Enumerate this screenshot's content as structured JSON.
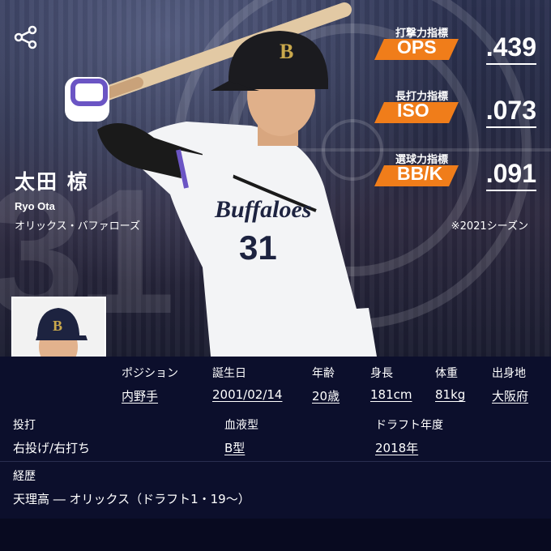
{
  "player": {
    "name_jp": "太田 椋",
    "name_en": "Ryo Ota",
    "team": "オリックス・バファローズ",
    "uniform_number": "31"
  },
  "stats": [
    {
      "label": "打撃力指標",
      "abbr": "OPS",
      "value": ".439"
    },
    {
      "label": "長打力指標",
      "abbr": "ISO",
      "value": ".073"
    },
    {
      "label": "選球力指標",
      "abbr": "BB/K",
      "value": ".091"
    }
  ],
  "season_note": "※2021シーズン",
  "bio_row1": [
    {
      "label": "ポジション",
      "value": "内野手"
    },
    {
      "label": "誕生日",
      "value": "2001/02/14"
    },
    {
      "label": "年齢",
      "value": "20歳"
    },
    {
      "label": "身長",
      "value": "181cm"
    },
    {
      "label": "体重",
      "value": "81kg"
    },
    {
      "label": "出身地",
      "value": "大阪府"
    }
  ],
  "bio_row2": [
    {
      "label": "投打",
      "value": "右投げ/右打ち"
    },
    {
      "label": "血液型",
      "value": "B型"
    },
    {
      "label": "ドラフト年度",
      "value": "2018年"
    }
  ],
  "career": {
    "label": "経歴",
    "value": "天理高 ― オリックス（ドラフト1・19〜）"
  },
  "colors": {
    "accent": "#f07d1a",
    "background": "#0c0f2c"
  },
  "icons": {
    "share": "share-icon"
  }
}
